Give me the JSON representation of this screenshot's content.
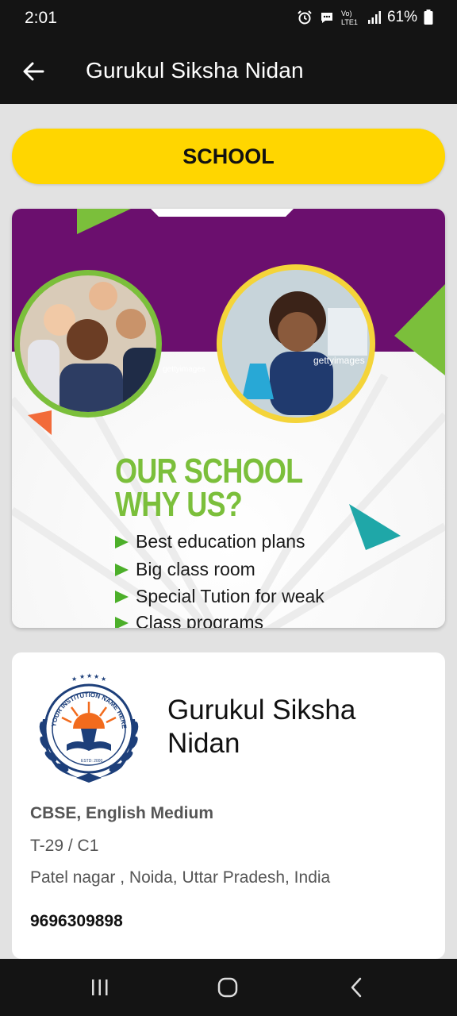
{
  "status_bar": {
    "time": "2:01",
    "network_label": "Vo) LTE1",
    "battery_percent": "61%",
    "icons": [
      "alarm-icon",
      "whatsapp-icon",
      "volte-icon",
      "signal-icon",
      "battery-icon"
    ]
  },
  "app_bar": {
    "title": "Gurukul Siksha Nidan",
    "back_icon": "arrow-left-icon"
  },
  "category_button": {
    "label": "SCHOOL"
  },
  "banner": {
    "watermark": "gettyimages",
    "heading_line1": "OUR SCHOOL",
    "heading_line2": "WHY US?",
    "bullets": [
      "Best education plans",
      "Big class room",
      "Special Tution for weak",
      "Class programs"
    ],
    "colors": {
      "purple": "#6b0f6e",
      "green": "#7bbf3b",
      "yellow": "#f4d43a",
      "teal": "#1fa7a8",
      "orange": "#f26b3a"
    }
  },
  "institution": {
    "logo_text": "YOUR INSTITUTION NAME HERE",
    "logo_estd": "ESTD: 2000",
    "name": "Gurukul Siksha Nidan",
    "board": "CBSE, English Medium",
    "address_line1": "T-29 / C1",
    "address_line2": "Patel nagar , Noida, Uttar Pradesh, India",
    "phone": "9696309898"
  },
  "nav_bar": {
    "icons": [
      "recent-apps-icon",
      "home-icon",
      "back-icon"
    ]
  }
}
